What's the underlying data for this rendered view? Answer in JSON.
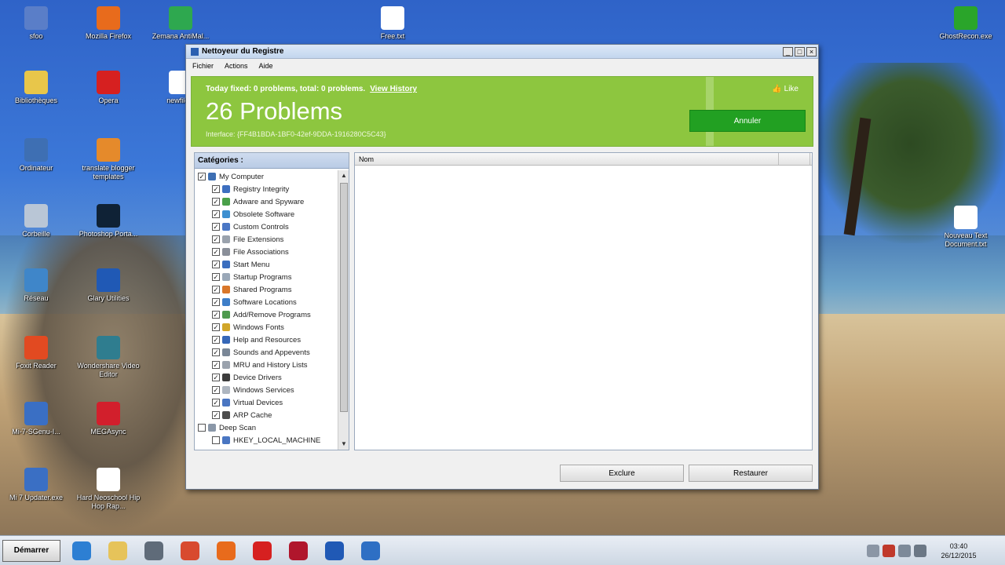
{
  "desktop": {
    "icons": [
      {
        "label": "sfoo",
        "icon": "folder-icon",
        "color": "#5a7ec8"
      },
      {
        "label": "Mozilla Firefox",
        "icon": "firefox-icon",
        "color": "#e86b1c"
      },
      {
        "label": "Zemana AntiMal...",
        "icon": "zemana-icon",
        "color": "#2ea84f"
      },
      {
        "label": "Free.txt",
        "icon": "text-file-icon",
        "color": "#ffffff"
      },
      {
        "label": "GhostRecon.exe",
        "icon": "ghostrecon-icon",
        "color": "#2aa52a"
      },
      {
        "label": "Bibliothèques",
        "icon": "libraries-icon",
        "color": "#e8c64a"
      },
      {
        "label": "Opera",
        "icon": "opera-icon",
        "color": "#d62020"
      },
      {
        "label": "newfile...",
        "icon": "file-icon",
        "color": "#ffffff"
      },
      {
        "label": "Ordinateur",
        "icon": "computer-icon",
        "color": "#3e6fb3"
      },
      {
        "label": "translate blogger templates",
        "icon": "translate-icon",
        "color": "#e58a2b"
      },
      {
        "label": "Corbeille",
        "icon": "recycle-bin-icon",
        "color": "#b9c6d6"
      },
      {
        "label": "Photoshop Porta...",
        "icon": "photoshop-icon",
        "color": "#0f2236"
      },
      {
        "label": "Nouveau Text Document.txt",
        "icon": "text-file-icon",
        "color": "#ffffff"
      },
      {
        "label": "Réseau",
        "icon": "network-icon",
        "color": "#3f86c9"
      },
      {
        "label": "Glary Utilities",
        "icon": "glary-icon",
        "color": "#2059b5"
      },
      {
        "label": "Foxit Reader",
        "icon": "foxit-icon",
        "color": "#e24a21"
      },
      {
        "label": "Wondershare Video Editor",
        "icon": "video-editor-icon",
        "color": "#2f7d8f"
      },
      {
        "label": "Mi-7-SGenu-I...",
        "icon": "windows-icon",
        "color": "#3a6fc4"
      },
      {
        "label": "MEGAsync",
        "icon": "mega-icon",
        "color": "#d21f2c"
      },
      {
        "label": "Mi 7 Updater.exe",
        "icon": "windows-updater-icon",
        "color": "#3a6fc4"
      },
      {
        "label": "Hard Neoschool Hip Hop Rap...",
        "icon": "audio-file-icon",
        "color": "#ffffff"
      }
    ]
  },
  "window": {
    "title": "Nettoyeur du Registre",
    "controls": {
      "min": "_",
      "max": "□",
      "close": "×"
    },
    "menu": [
      "Fichier",
      "Actions",
      "Aide"
    ],
    "banner": {
      "fixed_text": "Today fixed: 0 problems, total: 0 problems.",
      "history_link": "View History",
      "problems": "26 Problems",
      "interface_text": "Interface: {FF4B1BDA-1BF0-42ef-9DDA-1916280C5C43}",
      "like": "Like",
      "annuler": "Annuler"
    },
    "categories": {
      "header": "Catégories :",
      "root": "My Computer",
      "items": [
        {
          "label": "Registry Integrity",
          "icon": "registry-icon",
          "color": "#3d6fc0"
        },
        {
          "label": "Adware and Spyware",
          "icon": "adware-icon",
          "color": "#4aa04a"
        },
        {
          "label": "Obsolete Software",
          "icon": "obsolete-icon",
          "color": "#3d8fd0"
        },
        {
          "label": "Custom Controls",
          "icon": "custom-controls-icon",
          "color": "#4b77c5"
        },
        {
          "label": "File Extensions",
          "icon": "file-ext-icon",
          "color": "#9aa2ad"
        },
        {
          "label": "File Associations",
          "icon": "file-assoc-icon",
          "color": "#8a8f99"
        },
        {
          "label": "Start Menu",
          "icon": "start-menu-icon",
          "color": "#3b6ebf"
        },
        {
          "label": "Startup Programs",
          "icon": "startup-icon",
          "color": "#9aa8b8"
        },
        {
          "label": "Shared Programs",
          "icon": "shared-icon",
          "color": "#d9772a"
        },
        {
          "label": "Software Locations",
          "icon": "software-loc-icon",
          "color": "#3e7ec8"
        },
        {
          "label": "Add/Remove Programs",
          "icon": "add-remove-icon",
          "color": "#4e9a4e"
        },
        {
          "label": "Windows Fonts",
          "icon": "fonts-icon",
          "color": "#d1a629"
        },
        {
          "label": "Help and Resources",
          "icon": "help-icon",
          "color": "#3567b8"
        },
        {
          "label": "Sounds and Appevents",
          "icon": "sounds-icon",
          "color": "#7a8797"
        },
        {
          "label": "MRU and History Lists",
          "icon": "mru-icon",
          "color": "#9aa2ad"
        },
        {
          "label": "Device Drivers",
          "icon": "drivers-icon",
          "color": "#3d3d3d"
        },
        {
          "label": "Windows Services",
          "icon": "services-icon",
          "color": "#aeb6c0"
        },
        {
          "label": "Virtual Devices",
          "icon": "virtual-devices-icon",
          "color": "#4a76c2"
        },
        {
          "label": "ARP Cache",
          "icon": "arp-icon",
          "color": "#4d4d4d"
        }
      ],
      "deep_scan": "Deep Scan",
      "deep_scan_item": "HKEY_LOCAL_MACHINE"
    },
    "list": {
      "columns": [
        "Nom",
        ""
      ]
    },
    "buttons": {
      "exclude": "Exclure",
      "restore": "Restaurer"
    }
  },
  "taskbar": {
    "start_label": "Démarrer",
    "apps": [
      {
        "icon": "ie-icon",
        "color": "#2d7fd3"
      },
      {
        "icon": "explorer-icon",
        "color": "#e6c35a"
      },
      {
        "icon": "media-icon",
        "color": "#5f6b79"
      },
      {
        "icon": "video-icon",
        "color": "#d84a2f"
      },
      {
        "icon": "firefox-icon",
        "color": "#e86b1c"
      },
      {
        "icon": "opera-icon",
        "color": "#d62020"
      },
      {
        "icon": "record-icon",
        "color": "#b0162c"
      },
      {
        "icon": "glary-icon",
        "color": "#2059b5"
      },
      {
        "icon": "registry-cleaner-icon",
        "color": "#2e6fc4"
      }
    ],
    "time": "03:40",
    "date": "26/12/2015"
  }
}
